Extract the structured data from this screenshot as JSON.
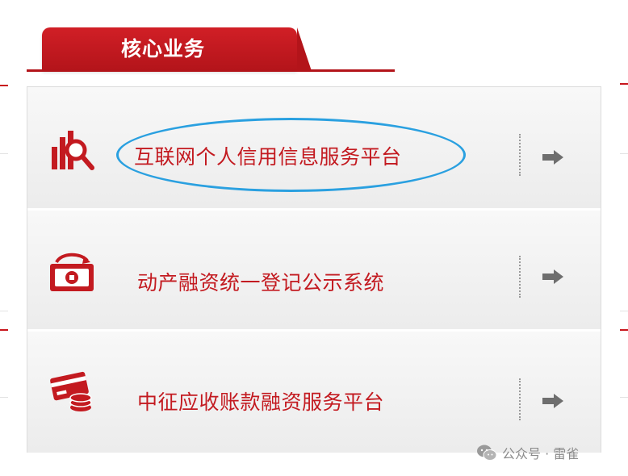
{
  "header": {
    "title": "核心业务"
  },
  "services": [
    {
      "label": "互联网个人信用信息服务平台",
      "icon": "credit-search-icon",
      "highlighted": true
    },
    {
      "label": "动产融资统一登记公示系统",
      "icon": "money-cycle-icon",
      "highlighted": false
    },
    {
      "label": "中征应收账款融资服务平台",
      "icon": "card-coins-icon",
      "highlighted": false
    }
  ],
  "watermark": {
    "text": "公众号 · 雷雀",
    "icon": "wechat-icon"
  },
  "colors": {
    "brand_red": "#c31a20",
    "highlight_blue": "#2aa0e0",
    "arrow_gray": "#6e6e6e"
  }
}
